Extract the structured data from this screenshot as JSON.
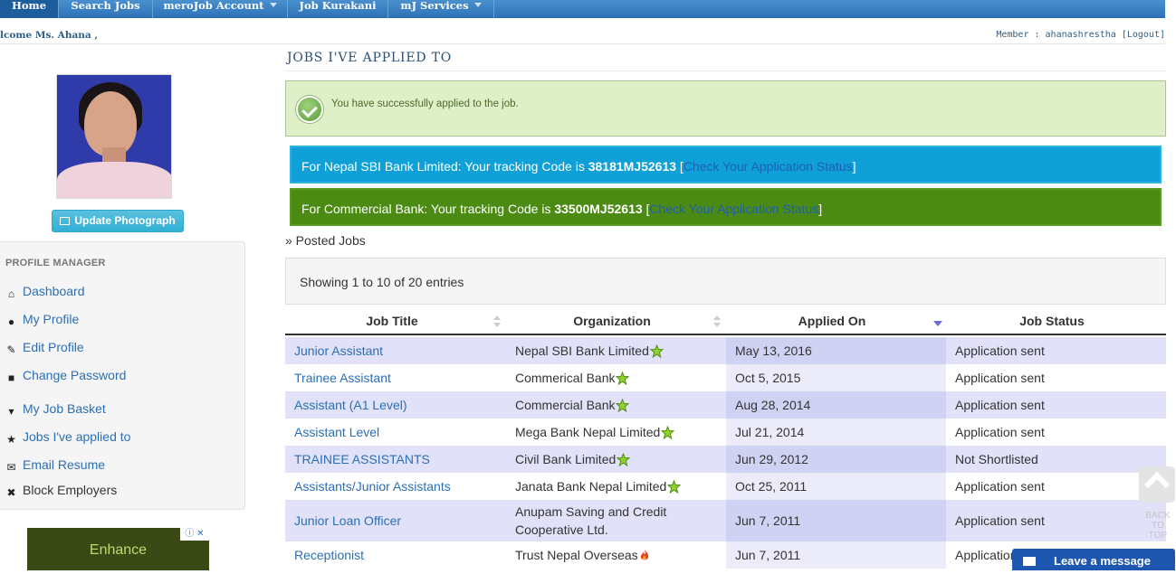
{
  "nav": {
    "items": [
      {
        "label": "Home",
        "dropdown": false
      },
      {
        "label": "Search Jobs",
        "dropdown": false
      },
      {
        "label": "meroJob Account",
        "dropdown": true
      },
      {
        "label": "Job Kurakani",
        "dropdown": false
      },
      {
        "label": "mJ Services",
        "dropdown": true
      }
    ]
  },
  "header": {
    "welcome": "lcome Ms. Ahana ,",
    "member_label": "Member : ahanashrestha",
    "logout": "[Logout]"
  },
  "sidebar": {
    "update_photo_label": "Update Photograph",
    "panel_title": "PROFILE MANAGER",
    "items": [
      {
        "label": "Dashboard",
        "icon": "home-icon",
        "link": true
      },
      {
        "label": "My Profile",
        "icon": "user-icon",
        "link": true
      },
      {
        "label": "Edit Profile",
        "icon": "edit-icon",
        "link": true
      },
      {
        "label": "Change Password",
        "icon": "lock-icon",
        "link": true
      },
      {
        "label": "My Job Basket",
        "icon": "basket-icon",
        "link": true
      },
      {
        "label": "Jobs I've applied to",
        "icon": "star-icon",
        "link": true
      },
      {
        "label": "Email Resume",
        "icon": "envelope-icon",
        "link": true
      },
      {
        "label": "Block Employers",
        "icon": "close-icon",
        "link": false
      }
    ],
    "ad_text": "Enhance"
  },
  "main": {
    "title": "JOBS I'VE APPLIED TO",
    "success_message": "You have successfully applied to the job.",
    "tracking": [
      {
        "prefix": "For Nepal SBI Bank Limited: Your tracking Code is ",
        "code": "38181MJ52613",
        "open": " [",
        "link": "Check Your Application Status",
        "close": "]"
      },
      {
        "prefix": "For Commercial Bank: Your tracking Code is ",
        "code": "33500MJ52613",
        "open": " [",
        "link": "Check Your Application Status",
        "close": "]"
      }
    ],
    "posted_jobs": "» Posted Jobs",
    "entries_info": "Showing 1 to 10 of 20 entries"
  },
  "table": {
    "columns": [
      "Job Title",
      "Organization",
      "Applied On",
      "Job Status"
    ],
    "rows": [
      {
        "title": "Junior Assistant",
        "org": "Nepal SBI Bank Limited",
        "badge": "star",
        "date": "May 13, 2016",
        "status": "Application sent"
      },
      {
        "title": "Trainee Assistant",
        "org": "Commerical Bank",
        "badge": "star",
        "date": "Oct 5, 2015",
        "status": "Application sent"
      },
      {
        "title": "Assistant (A1 Level)",
        "org": "Commercial Bank",
        "badge": "star",
        "date": "Aug 28, 2014",
        "status": "Application sent"
      },
      {
        "title": "Assistant Level",
        "org": "Mega Bank Nepal Limited",
        "badge": "star",
        "date": "Jul 21, 2014",
        "status": "Application sent"
      },
      {
        "title": "TRAINEE ASSISTANTS",
        "org": "Civil Bank Limited",
        "badge": "star",
        "date": "Jun 29, 2012",
        "status": "Not Shortlisted"
      },
      {
        "title": "Assistants/Junior Assistants",
        "org": "Janata Bank Nepal Limited",
        "badge": "star",
        "date": "Oct 25, 2011",
        "status": "Application sent"
      },
      {
        "title": "Junior Loan Officer",
        "org": "Anupam Saving and Credit Cooperative Ltd.",
        "badge": "",
        "date": "Jun 7, 2011",
        "status": "Application sent"
      },
      {
        "title": "Receptionist",
        "org": "Trust Nepal Overseas",
        "badge": "fire",
        "date": "Jun 7, 2011",
        "status": "Application"
      }
    ]
  },
  "widgets": {
    "back_to_top": "BACK TO TOP",
    "leave_message": "Leave a message"
  },
  "colors": {
    "nav_blue": "#2f74b8",
    "tracking_blue": "#0ea0d6",
    "tracking_green": "#4b8a13",
    "success_bg": "#dff0c8",
    "link": "#2a6fb5"
  }
}
